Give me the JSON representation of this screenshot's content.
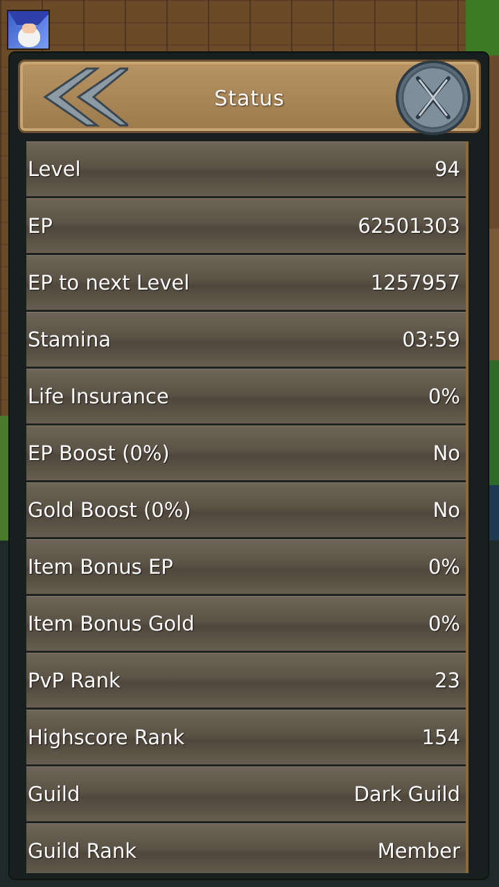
{
  "header": {
    "title": "Status"
  },
  "icons": {
    "back": "chevron-left-double-icon",
    "close": "close-icon",
    "avatar": "wizard-avatar-icon"
  },
  "colors": {
    "header_bg": "#b08c5c",
    "row_bg": "#5f5749",
    "panel_bg": "#17201e",
    "text": "#ffffff"
  },
  "rows": [
    {
      "label": "Level",
      "value": "94"
    },
    {
      "label": "EP",
      "value": "62501303"
    },
    {
      "label": "EP to next Level",
      "value": "1257957"
    },
    {
      "label": "Stamina",
      "value": "03:59"
    },
    {
      "label": "Life Insurance",
      "value": "0%"
    },
    {
      "label": "EP Boost (0%)",
      "value": "No"
    },
    {
      "label": "Gold Boost (0%)",
      "value": "No"
    },
    {
      "label": "Item Bonus EP",
      "value": "0%"
    },
    {
      "label": "Item Bonus Gold",
      "value": "0%"
    },
    {
      "label": "PvP Rank",
      "value": "23"
    },
    {
      "label": "Highscore Rank",
      "value": "154"
    },
    {
      "label": "Guild",
      "value": "Dark Guild"
    },
    {
      "label": "Guild Rank",
      "value": "Member"
    }
  ]
}
